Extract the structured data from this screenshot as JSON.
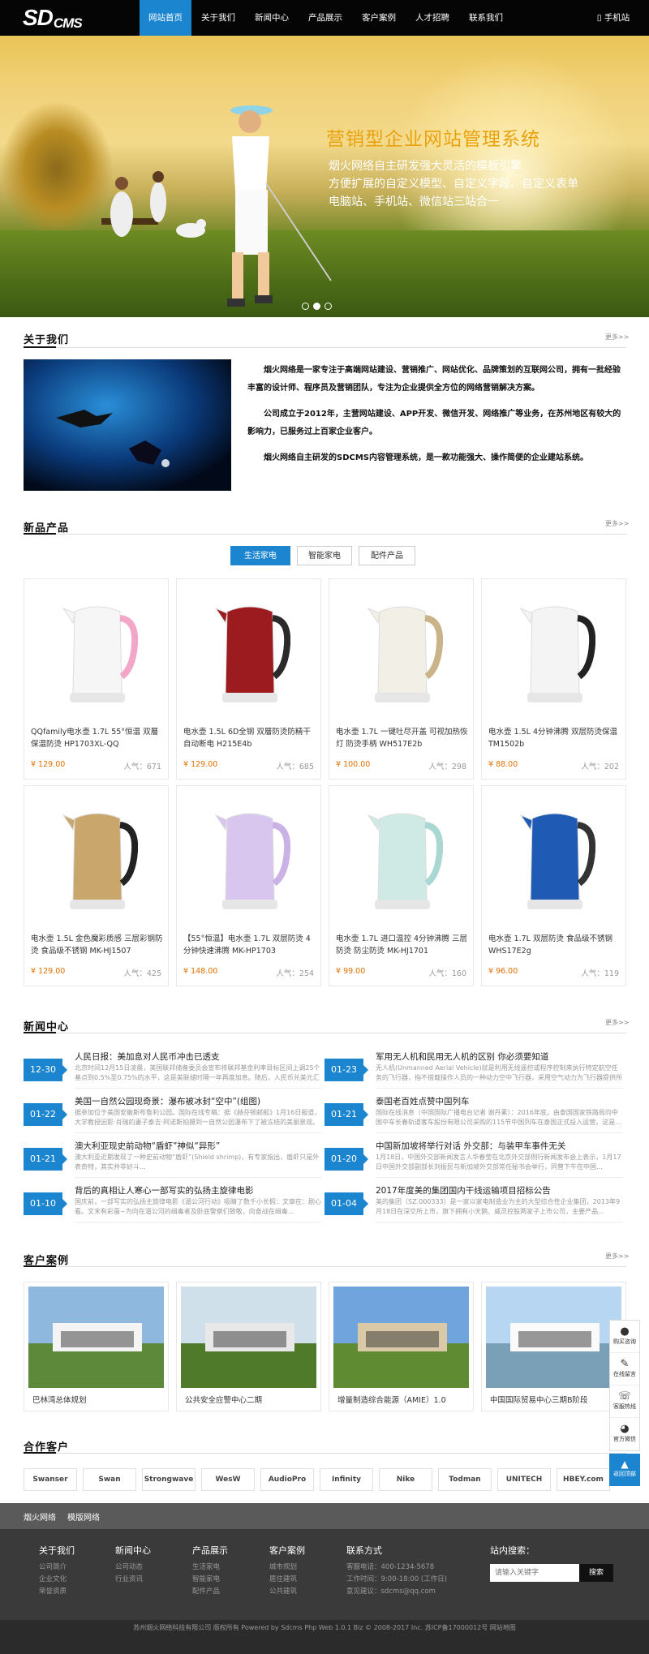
{
  "nav": {
    "logo_main": "SD",
    "logo_sub": "CMS",
    "items": [
      "网站首页",
      "关于我们",
      "新闻中心",
      "产品展示",
      "客户案例",
      "人才招聘",
      "联系我们"
    ],
    "mobile": "手机站"
  },
  "hero": {
    "title": "营销型企业网站管理系统",
    "lines": [
      "烟火网络自主研发强大灵活的模板引擎",
      "方便扩展的自定义模型、自定义字段、自定义表单",
      "电脑站、手机站、微信站三站合一"
    ]
  },
  "about": {
    "title": "关于我们",
    "more": "更多>>",
    "text": [
      "烟火网络是一家专注于高端网站建设、营销推广、网站优化、品牌策划的互联网公司，拥有一批经验丰富的设计师、程序员及营销团队，专注为企业提供全方位的网络营销解决方案。",
      "公司成立于2012年，主营网站建设、APP开发、微信开发、网络推广等业务，在苏州地区有较大的影响力，已服务过上百家企业客户。",
      "烟火网络自主研发的SDCMS内容管理系统，是一款功能强大、操作简便的企业建站系统。"
    ]
  },
  "products": {
    "title": "新品产品",
    "more": "更多>>",
    "tabs": [
      "生活家电",
      "智能家电",
      "配件产品"
    ],
    "popularity_label": "人气：",
    "items": [
      {
        "name": "QQfamily电水壶 1.7L 55°恒温 双層保温防烫 HP1703XL-QQ",
        "price": "¥ 129.00",
        "views": "671",
        "body": "#f6f6f6",
        "accent": "#f2a6c8"
      },
      {
        "name": "电水壶 1.5L 6D全钢 双層防烫防精干 自动断电 H215E4b",
        "price": "¥ 129.00",
        "views": "685",
        "body": "#9b1b1f",
        "accent": "#2a2a2a"
      },
      {
        "name": "电水壶 1.7L 一键吐尽开盖 可视加热恢灯 防烫手柄 WH517E2b",
        "price": "¥ 100.00",
        "views": "298",
        "body": "#f2efe6",
        "accent": "#c9b48a"
      },
      {
        "name": "电水壶 1.5L 4分钟沸腾 双层防烫保温 TM1502b",
        "price": "¥ 88.00",
        "views": "202",
        "body": "#f4f4f4",
        "accent": "#222222"
      },
      {
        "name": "电水壶 1.5L 金色魔彩质感 三层彩钢防烫 食品级不锈钢 MK-HJ1507",
        "price": "¥ 129.00",
        "views": "425",
        "body": "#c8a66c",
        "accent": "#222222"
      },
      {
        "name": "【55°恒温】电水壶 1.7L 双层防烫 4分钟快速沸腾 MK-HP1703",
        "price": "¥ 148.00",
        "views": "254",
        "body": "#d9c6ee",
        "accent": "#cbb2e6"
      },
      {
        "name": "电水壶 1.7L 进口温控 4分钟沸腾 三层防烫 防尘防烫 MK-HJ1701",
        "price": "¥ 99.00",
        "views": "160",
        "body": "#cfe9e5",
        "accent": "#a9d8d2"
      },
      {
        "name": "电水壶 1.7L 双层防烫 食品级不锈钢 WHS17E2g",
        "price": "¥ 96.00",
        "views": "119",
        "body": "#1f5bb5",
        "accent": "#333333"
      }
    ]
  },
  "news": {
    "title": "新闻中心",
    "more": "更多>>",
    "items": [
      {
        "date": "12-30",
        "title": "人民日报：美加息对人民币冲击已透支",
        "desc": "北京时间12月15日凌晨，美国联邦储备委员会宣布将联邦基金利率目标区间上调25个基点到0.5%至0.75%的水平，这是美联储时隔一年再度加息。随后，人民币兑美元汇率..."
      },
      {
        "date": "01-23",
        "title": "军用无人机和民用无人机的区别 你必须要知道",
        "desc": "无人机(Unmanned Aerial Vehicle)就是利用无线遥控或程序控制来执行特定航空任务的飞行器，指不搭载操作人员的一种动力空中飞行器，采用空气动力为飞行器提供所需的升力..."
      },
      {
        "date": "01-22",
        "title": "美国一自然公园现奇景：瀑布被冰封“空中”(组图)",
        "desc": "据参加位于美国安徽斯布鲁利公园。国际在线专稿：据《赫芬顿邮报》1月16日报道，大学教授因影·肖瑞的妻子泰吉·阿诺斯拍摄到一自然公园瀑布下了被冻结的美丽景观。"
      },
      {
        "date": "01-21",
        "title": "泰国老百姓点赞中国列车",
        "desc": "国际在线消息（中国国际广播电台记者 谢丹素）：2016年底，由泰国国家铁路局向中国中车长春轨道客车股份有限公司采购的115节中国列车在泰国正式投入运营。这是..."
      },
      {
        "date": "01-21",
        "title": "澳大利亚现史前动物“盾虾”神似“异形”",
        "desc": "澳大利亚近期发现了一种史前动物“盾虾”(Shield shrimp)，有专家指出，盾虾只是外表奇特，其实并非好斗..."
      },
      {
        "date": "01-20",
        "title": "中国新加坡将举行对话 外交部：与装甲车事件无关",
        "desc": "1月18日，中国外交部新闻发言人华春莹在北京外交部例行新闻发布会上表示，1月17日中国外交部副部长刘振民与新加坡外交部常任秘书会举行，同曾下午在中国..."
      },
      {
        "date": "01-10",
        "title": "背后的真相让人寒心一部写实的弘扬主旋律电影",
        "desc": "国庆前，一部写实的弘扬主旋律电影《湄公河行动》吸睛了数千小长假：文章在：剧心看。文末有彩蛋~为向在湄公河的缉毒者及卧底警察们致敬，向奋战在缉毒..."
      },
      {
        "date": "01-04",
        "title": "2017年度美的集团国内干线运输项目招标公告",
        "desc": "美的集团（SZ.000333）是一家以家电制造业为主的大型综合性企业集团，2013年9月18日在深交所上市，旗下拥有小天鹅、威灵控股两家子上市公司，主要产品..."
      }
    ]
  },
  "cases": {
    "title": "客户案例",
    "more": "更多>>",
    "items": [
      "巴林湾总体规划",
      "公共安全应警中心二期",
      "增量制造综合能源（AMIE）1.0",
      "中国国际贸易中心三期B阶段"
    ]
  },
  "partners": {
    "title": "合作客户",
    "items": [
      "Swanser",
      "Swan",
      "Strongwave",
      "WesW",
      "AudioPro",
      "Infinity",
      "Nike",
      "Todman",
      "UNITECH",
      "HBEY.com"
    ]
  },
  "sidebar": {
    "items": [
      "购买咨询",
      "在线留言",
      "客服热线",
      "官方微信"
    ],
    "top": "返回顶部"
  },
  "footer": {
    "links": [
      "烟火网络",
      "模版网络"
    ],
    "cols": [
      {
        "title": "关于我们",
        "links": [
          "公司简介",
          "企业文化",
          "荣誉资质"
        ]
      },
      {
        "title": "新闻中心",
        "links": [
          "公司动态",
          "行业资讯"
        ]
      },
      {
        "title": "产品展示",
        "links": [
          "生活家电",
          "智能家电",
          "配件产品"
        ]
      },
      {
        "title": "客户案例",
        "links": [
          "城市规划",
          "居住建筑",
          "公共建筑"
        ]
      }
    ],
    "contact_title": "联系方式",
    "contact": [
      "客服电话：400-1234-5678",
      "工作时间：9:00-18:00 (工作日)",
      "意见建议：sdcms@qq.com"
    ],
    "search_title": "站内搜索：",
    "search_placeholder": "请输入关键字",
    "search_btn": "搜索",
    "copyright": "苏州烟火网络科技有限公司  版权所有  Powered by Sdcms Php Web 1.0.1 Biz © 2008-2017 Inc.  苏ICP备17000012号  网站地图"
  }
}
